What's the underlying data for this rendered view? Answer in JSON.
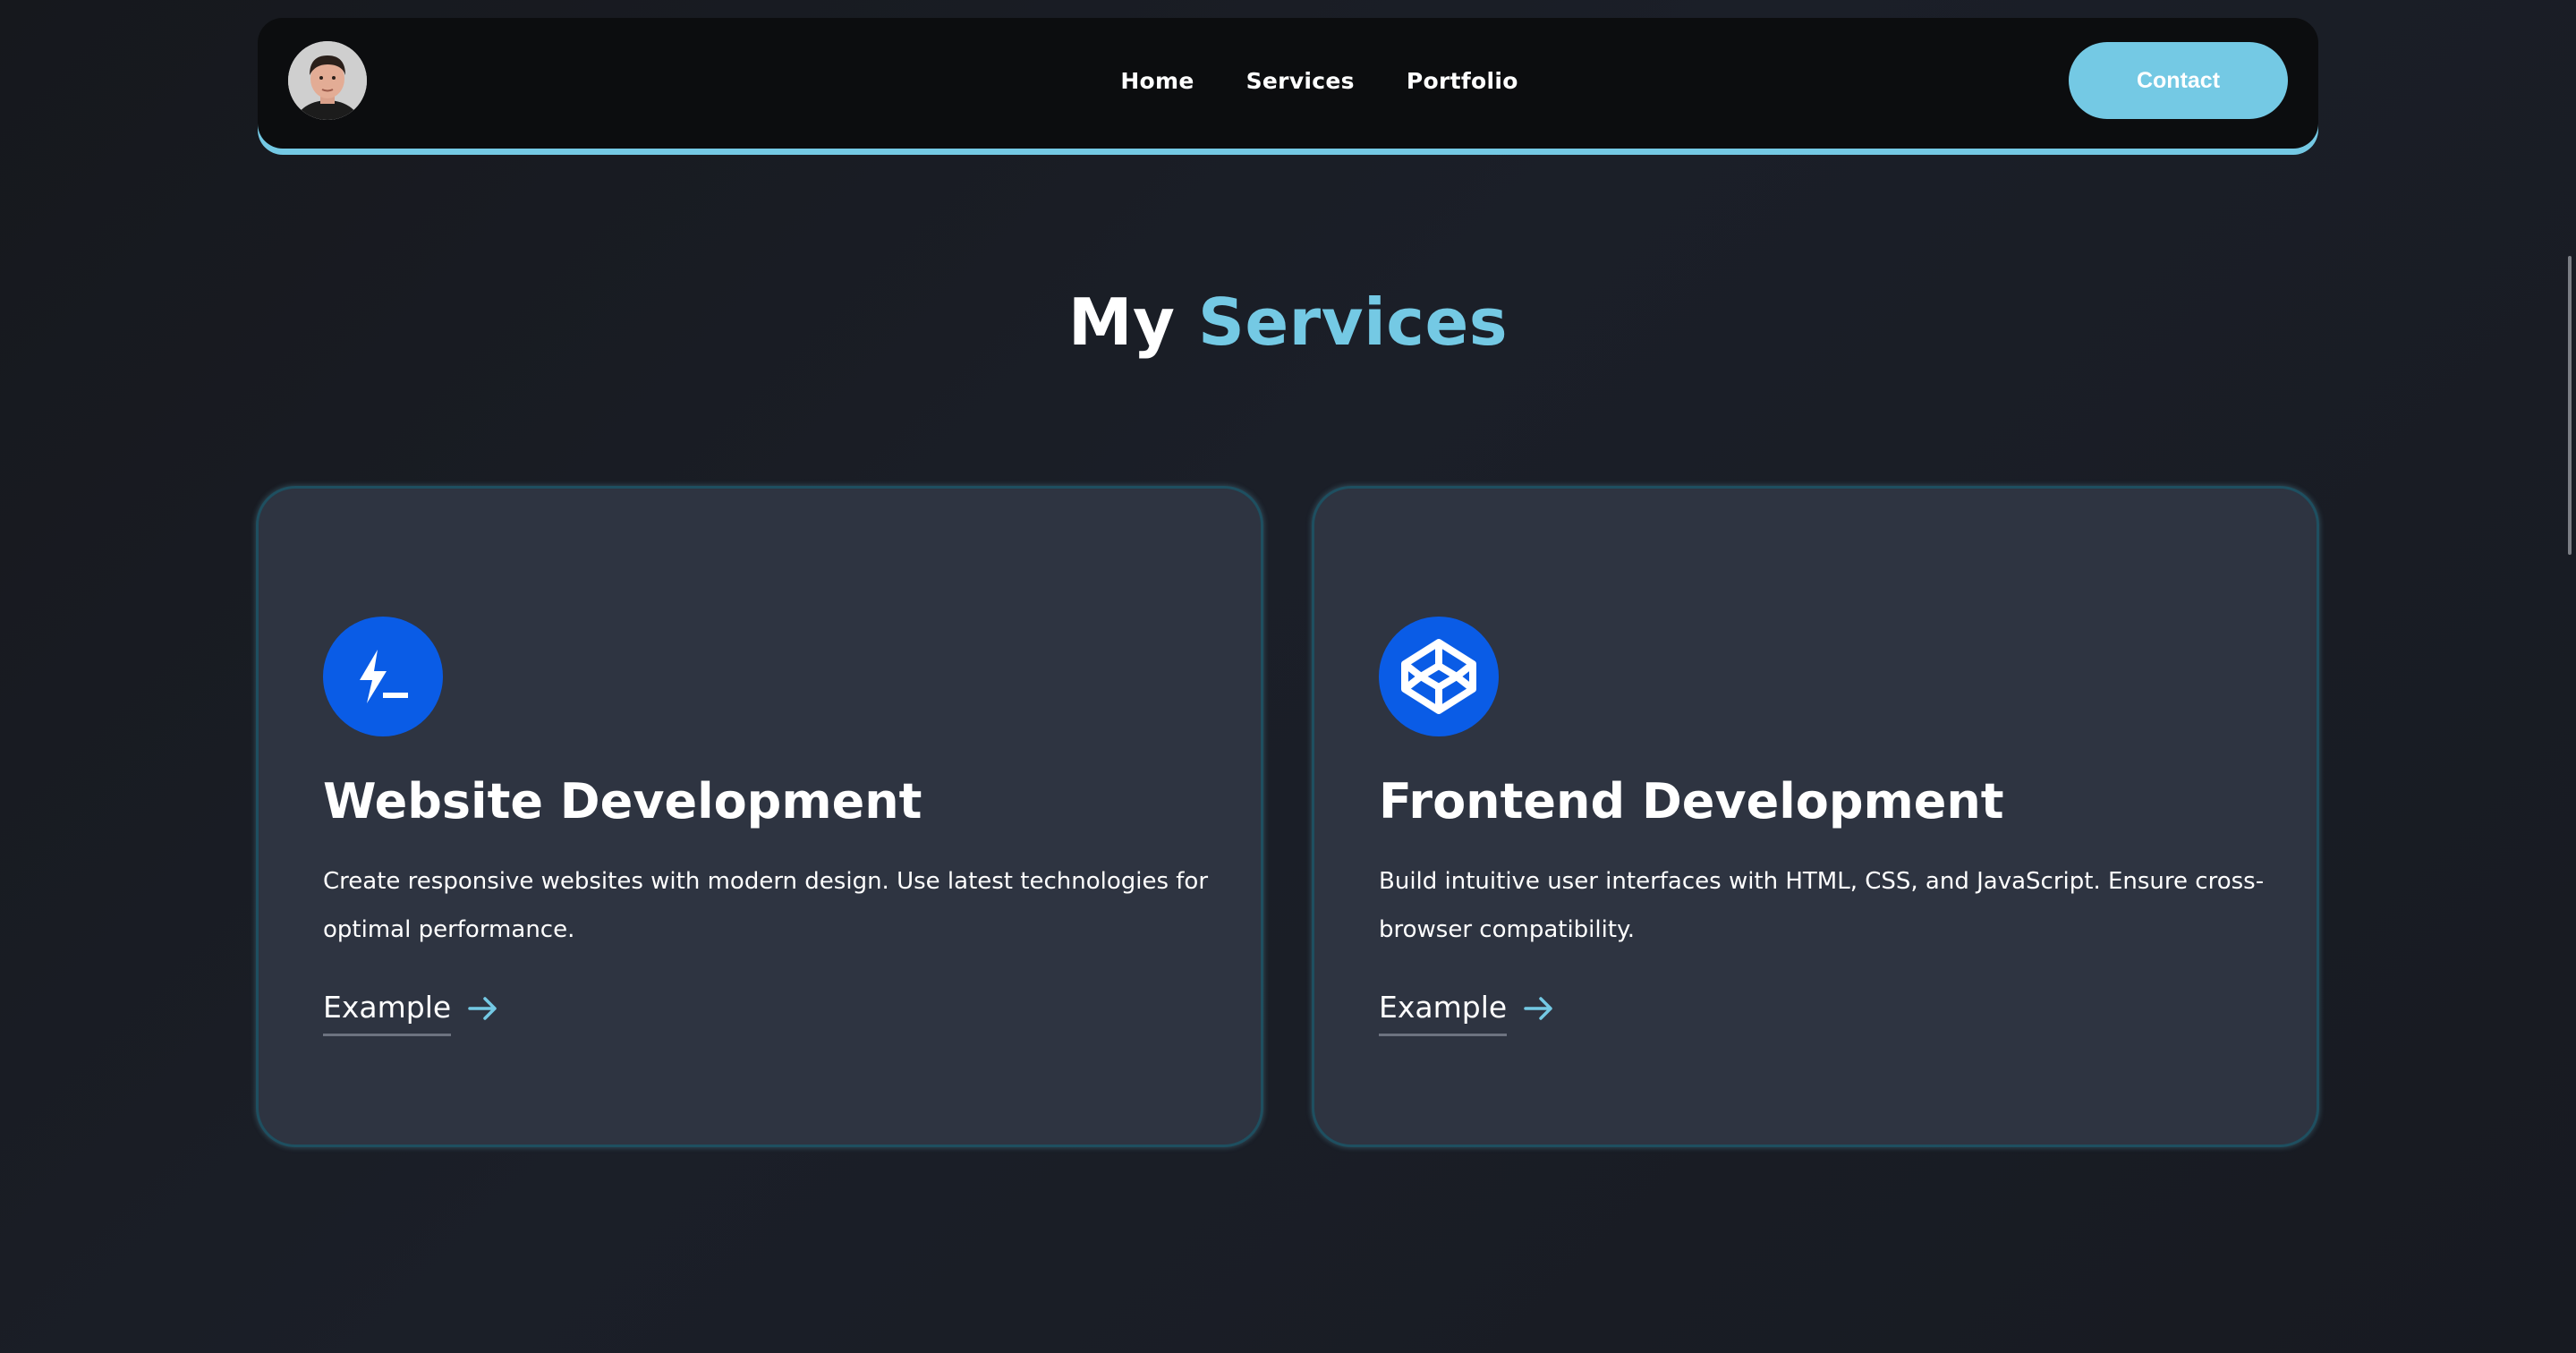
{
  "nav": {
    "avatar_alt": "profile photo",
    "links": [
      "Home",
      "Services",
      "Portfolio"
    ],
    "contact_label": "Contact"
  },
  "section": {
    "title_plain": "My",
    "title_accent": "Services"
  },
  "cards": [
    {
      "icon": "terminal-bolt-icon",
      "title": "Website Development",
      "description": "Create responsive websites with modern design. Use latest technologies for optimal performance.",
      "link_label": "Example"
    },
    {
      "icon": "codepen-cube-icon",
      "title": "Frontend Development",
      "description": "Build intuitive user interfaces with HTML, CSS, and JavaScript. Ensure cross-browser compatibility.",
      "link_label": "Example"
    }
  ],
  "colors": {
    "accent": "#74c9e4",
    "icon_bg": "#0a5ce6",
    "card_bg": "#2e3441",
    "nav_bg": "#0c0d0f"
  }
}
